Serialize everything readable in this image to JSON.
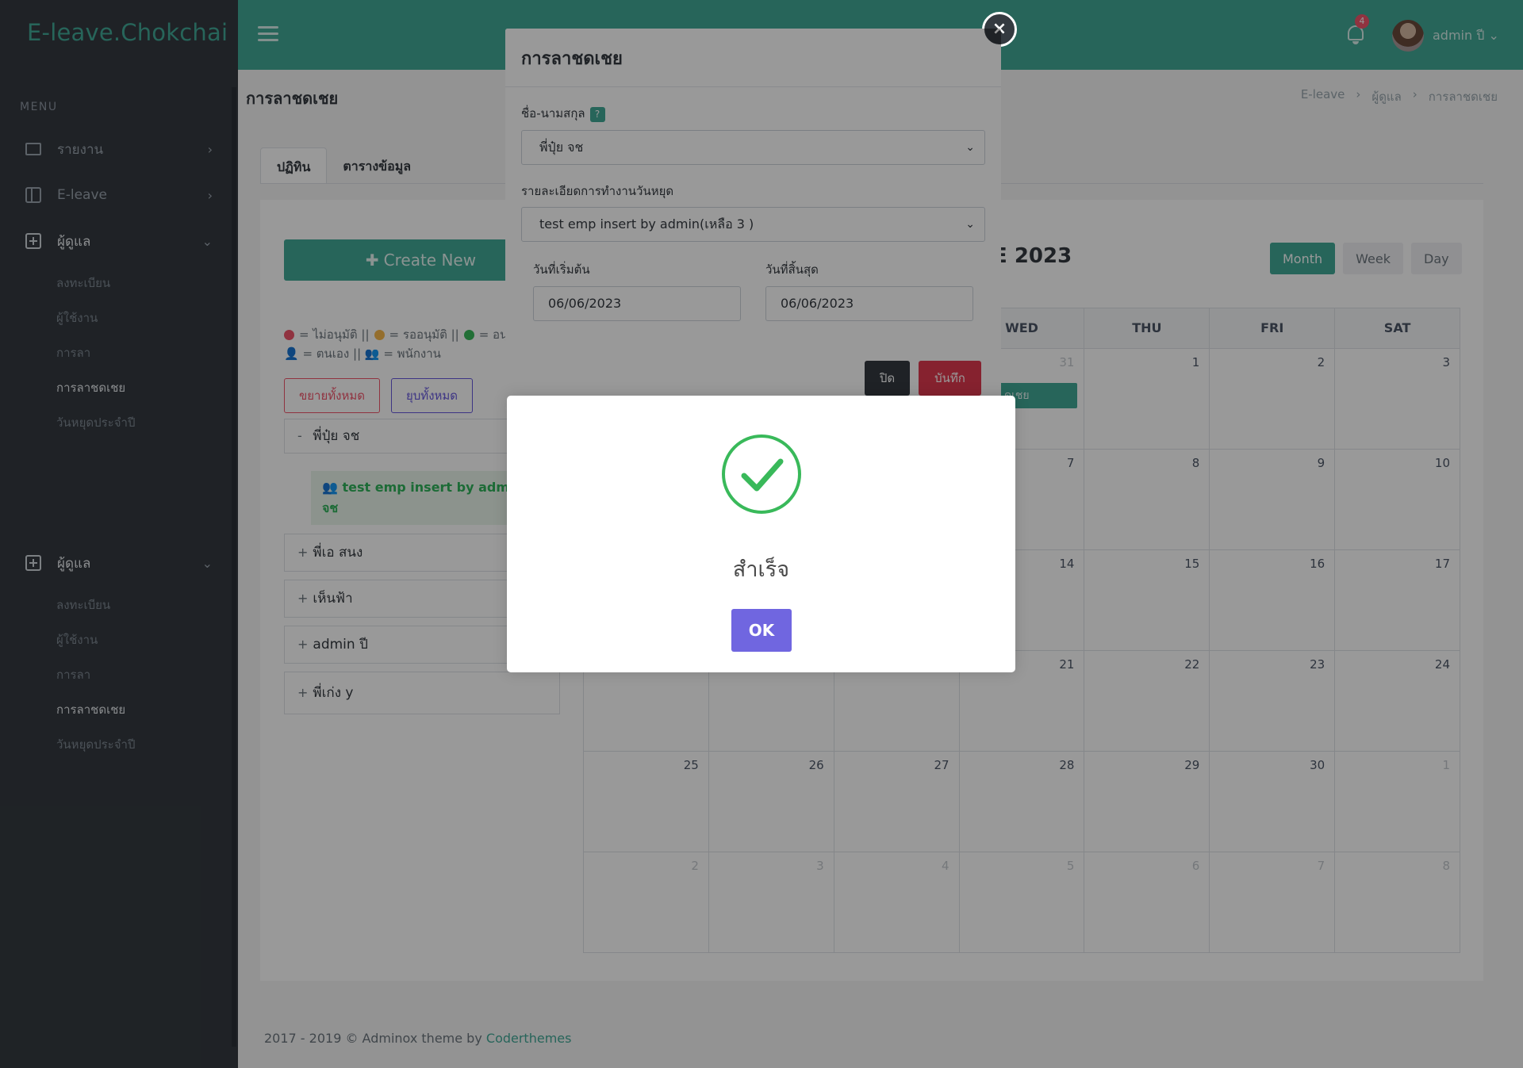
{
  "app": {
    "logo": "E-leave.Chokchai"
  },
  "sidebar": {
    "menu_title": "MENU",
    "items": [
      {
        "label": "รายงาน",
        "icon": "monitor-icon"
      },
      {
        "label": "E-leave",
        "icon": "book-icon"
      },
      {
        "label": "ผู้ดูแล",
        "icon": "plus-square-icon"
      }
    ],
    "sub_items": [
      "ลงทะเบียน",
      "ผู้ใช้งาน",
      "การลา",
      "การลาชดเชย",
      "วันหยุดประจำปี"
    ],
    "dup_item": {
      "label": "ผู้ดูแล"
    },
    "dup_sub_items": [
      "ลงทะเบียน",
      "ผู้ใช้งาน",
      "การลา",
      "การลาชดเชย",
      "วันหยุดประจำปี"
    ]
  },
  "topbar": {
    "notification_count": "4",
    "user": "admin ปี"
  },
  "page": {
    "title": "การลาชดเชย",
    "breadcrumb": [
      "E-leave",
      "ผู้ดูแล",
      "การลาชดเชย"
    ]
  },
  "tabs": [
    "ปฏิทิน",
    "ตารางข้อมูล"
  ],
  "left_panel": {
    "create_button": "Create New",
    "legend_line1": [
      "= ไม่อนุมัติ ||",
      "= รออนุมัติ ||",
      "= อนุ"
    ],
    "legend_line2": "= ตนเอง || 👥 = พนักงาน",
    "expand_all": "ขยายทั้งหมด",
    "collapse_all": "ยุบทั้งหมด",
    "accordion": [
      {
        "sign": "-",
        "name": "พี่ปุ๋ย จช"
      },
      {
        "sign": "+",
        "name": "พี่เอ สนง"
      },
      {
        "sign": "+",
        "name": "เห็นฟ้า"
      },
      {
        "sign": "+",
        "name": "admin ปี"
      },
      {
        "sign": "+",
        "name": "พี่เก่ง y"
      }
    ],
    "expanded_item": "test emp insert by admin",
    "expanded_item_2": "จช"
  },
  "calendar": {
    "title": "E 2023",
    "views": [
      "Month",
      "Week",
      "Day"
    ],
    "active_view": "Month",
    "weekday_headers": [
      "",
      "",
      "",
      "WED",
      "THU",
      "FRI",
      "SAT"
    ],
    "weeks": [
      [
        "",
        "",
        "",
        "31",
        "1",
        "2",
        "3"
      ],
      [
        "",
        "",
        "",
        "7",
        "8",
        "9",
        "10"
      ],
      [
        "",
        "",
        "",
        "14",
        "15",
        "16",
        "17"
      ],
      [
        "",
        "",
        "",
        "21",
        "22",
        "23",
        "24"
      ],
      [
        "25",
        "26",
        "27",
        "28",
        "29",
        "30",
        "1"
      ],
      [
        "2",
        "3",
        "4",
        "5",
        "6",
        "7",
        "8"
      ]
    ],
    "event_label": "ดเชย"
  },
  "footer": {
    "text": "2017 - 2019 © Adminox theme by",
    "link": "Coderthemes"
  },
  "form_modal": {
    "title": "การลาชดเชย",
    "name_label": "ชื่อ-นามสกุล",
    "help": "?",
    "name_value": "พี่ปุ๋ย จช",
    "detail_label": "รายละเอียดการทำงานวันหยุด",
    "detail_value": "test emp insert by admin(เหลือ 3 )",
    "start_label": "วันที่เริ่มต้น",
    "start_value": "06/06/2023",
    "end_label": "วันที่สิ้นสุด",
    "end_value": "06/06/2023",
    "close_button": "ปิด",
    "save_button": "บันทึก",
    "close_icon": "×"
  },
  "success_dialog": {
    "title": "สำเร็จ",
    "ok": "OK",
    "icon": "check-circle-icon",
    "color": "#39b95a"
  },
  "colors": {
    "primary": "#41a897",
    "sidebar": "#343a40",
    "danger": "#f1556c",
    "ok_button": "#7066e0"
  }
}
